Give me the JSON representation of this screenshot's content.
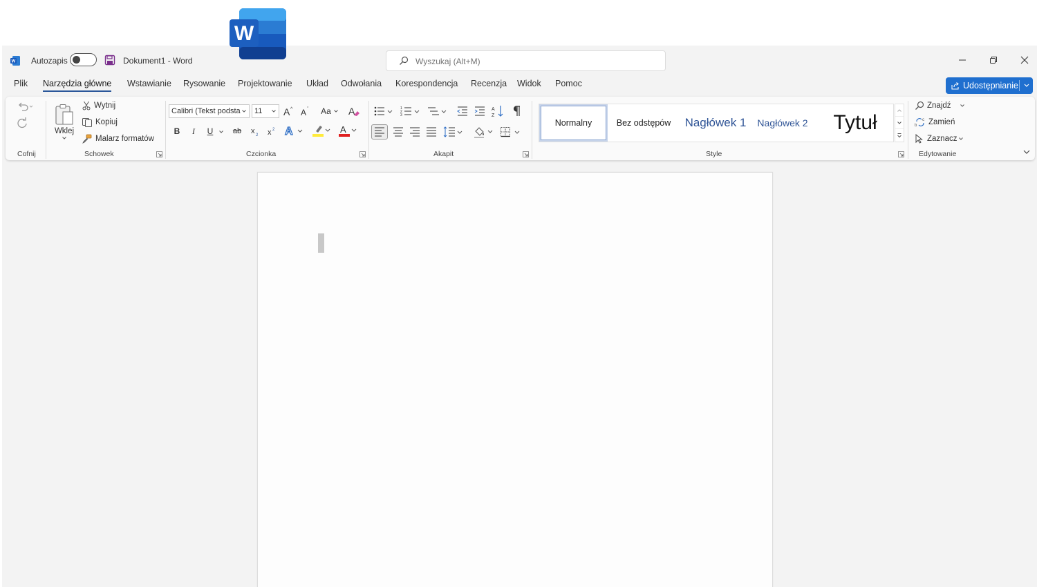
{
  "titlebar": {
    "autosave_label": "Autozapis",
    "doc_title": "Dokument1  -  Word",
    "search_placeholder": "Wyszukaj (Alt+M)"
  },
  "tabs": [
    {
      "label": "Plik",
      "active": false
    },
    {
      "label": "Narzędzia główne",
      "active": true
    },
    {
      "label": "Wstawianie",
      "active": false
    },
    {
      "label": "Rysowanie",
      "active": false
    },
    {
      "label": "Projektowanie",
      "active": false
    },
    {
      "label": "Układ",
      "active": false
    },
    {
      "label": "Odwołania",
      "active": false
    },
    {
      "label": "Korespondencja",
      "active": false
    },
    {
      "label": "Recenzja",
      "active": false
    },
    {
      "label": "Widok",
      "active": false
    },
    {
      "label": "Pomoc",
      "active": false
    }
  ],
  "share_button": "Udostępnianie",
  "ribbon": {
    "undo_group": "Cofnij",
    "clipboard": {
      "group": "Schowek",
      "paste": "Wklej",
      "cut": "Wytnij",
      "copy": "Kopiuj",
      "format_painter": "Malarz formatów"
    },
    "font": {
      "group": "Czcionka",
      "font_name": "Calibri (Tekst podsta",
      "font_size": "11",
      "bold": "B",
      "italic": "I",
      "underline": "U",
      "strike": "ab",
      "change_case": "Aa"
    },
    "paragraph": {
      "group": "Akapit"
    },
    "styles": {
      "group": "Style",
      "items": [
        "Normalny",
        "Bez odstępów",
        "Nagłówek 1",
        "Nagłówek 2",
        "Tytuł"
      ]
    },
    "editing": {
      "group": "Edytowanie",
      "find": "Znajdź",
      "replace": "Zamień",
      "select": "Zaznacz"
    }
  },
  "colors": {
    "accent": "#2b579a",
    "share": "#1f6fcf",
    "highlight": "#ffeb3b",
    "font_color": "#e02020"
  }
}
